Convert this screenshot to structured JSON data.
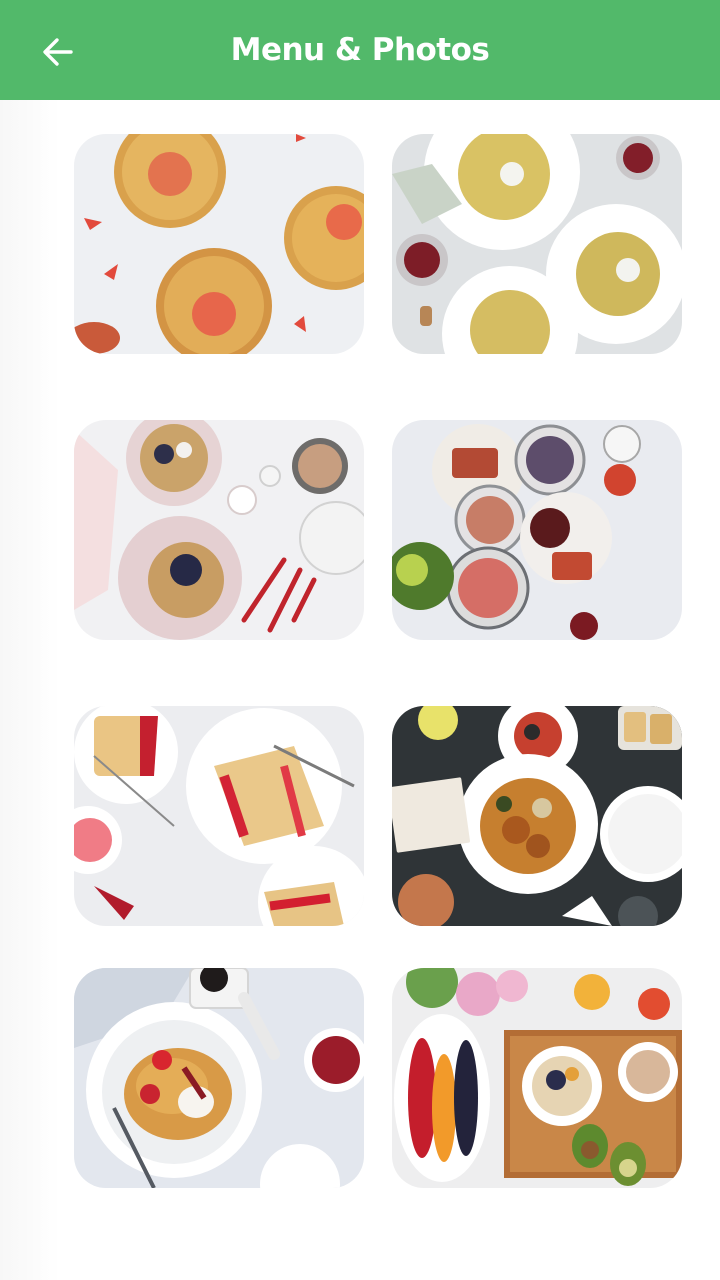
{
  "app_bar": {
    "title": "Menu & Photos",
    "background": "#52b96a",
    "back_icon": "arrow-left-icon"
  },
  "photos": [
    {
      "subject": "strawberry-buns"
    },
    {
      "subject": "spaghetti-plates-wine"
    },
    {
      "subject": "waffles-blueberries-tea"
    },
    {
      "subject": "breakfast-bowls-marble"
    },
    {
      "subject": "strawberry-cake-slices"
    },
    {
      "subject": "meatballs-dinner-table"
    },
    {
      "subject": "pancakes-strawberry-cream"
    },
    {
      "subject": "fruit-platter-breakfast"
    }
  ]
}
